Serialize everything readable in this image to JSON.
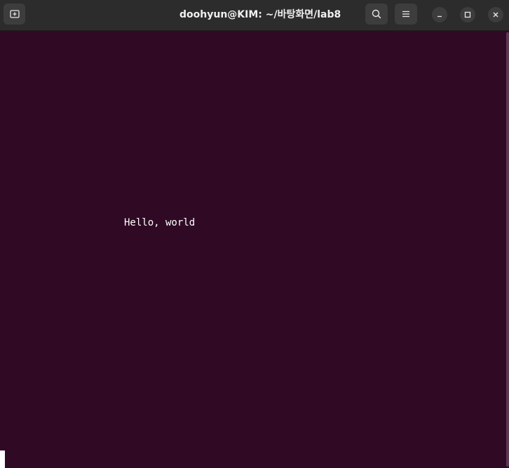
{
  "window": {
    "title": "doohyun@KIM: ~/바탕화면/lab8"
  },
  "titlebar": {
    "new_tab_icon": "new-tab-icon",
    "search_icon": "search-icon",
    "menu_icon": "hamburger-menu-icon",
    "minimize_icon": "minimize-icon",
    "maximize_icon": "maximize-icon",
    "close_icon": "close-icon"
  },
  "terminal": {
    "output_line": "Hello, world",
    "background_color": "#300a24",
    "text_color": "#ffffff"
  }
}
